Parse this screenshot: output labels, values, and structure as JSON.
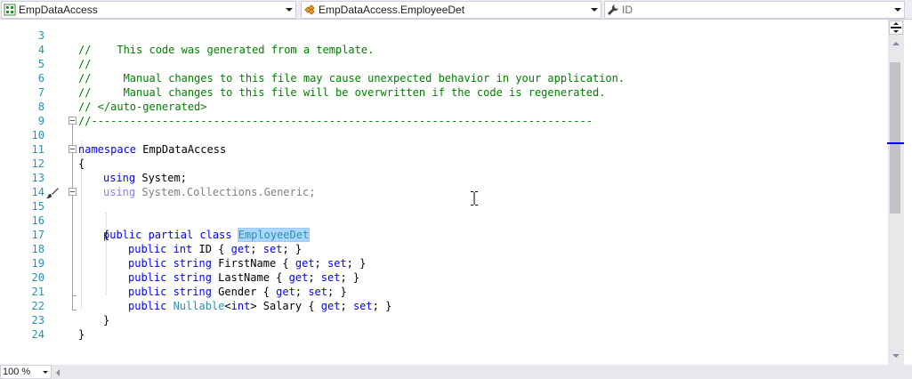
{
  "navbar": {
    "project": "EmpDataAccess",
    "type": "EmpDataAccess.EmployeeDet",
    "member": "ID"
  },
  "editor": {
    "lines": [
      {
        "num": "3",
        "code": "//    This code was generated from a template."
      },
      {
        "num": "4",
        "code": "//"
      },
      {
        "num": "5",
        "code": "//     Manual changes to this file may cause unexpected behavior in your application."
      },
      {
        "num": "6",
        "code": "//     Manual changes to this file will be overwritten if the code is regenerated."
      },
      {
        "num": "7",
        "code": "// </auto-generated>"
      },
      {
        "num": "8",
        "code": "//------------------------------------------------------------------------------"
      },
      {
        "num": "9",
        "code": ""
      },
      {
        "num": "10",
        "kw1": "namespace",
        "rest": " EmpDataAccess"
      },
      {
        "num": "11",
        "code": "{"
      },
      {
        "num": "12",
        "kw1": "using",
        "rest": " System;"
      },
      {
        "num": "13",
        "kw1": "using",
        "rest": " System.Collections.Generic;"
      },
      {
        "num": "14",
        "code": ""
      },
      {
        "num": "15",
        "kw1": "public partial class",
        "sel": "EmployeeDet"
      },
      {
        "num": "16",
        "code": "{"
      },
      {
        "num": "17",
        "kw1": "public int",
        "mid": " ID { ",
        "kw2": "get",
        "mid2": "; ",
        "kw3": "set",
        "end": "; }"
      },
      {
        "num": "18",
        "kw1": "public string",
        "mid": " FirstName { ",
        "kw2": "get",
        "mid2": "; ",
        "kw3": "set",
        "end": "; }"
      },
      {
        "num": "19",
        "kw1": "public string",
        "mid": " LastName { ",
        "kw2": "get",
        "mid2": "; ",
        "kw3": "set",
        "end": "; }"
      },
      {
        "num": "20",
        "kw1": "public string",
        "mid": " Gender { ",
        "kw2": "get",
        "mid2": "; ",
        "kw3": "set",
        "end": "; }"
      },
      {
        "num": "21",
        "kw1": "public",
        "ty": " Nullable",
        "mid0": "<",
        "kwint": "int",
        "mid": "> Salary { ",
        "kw2": "get",
        "mid2": "; ",
        "kw3": "set",
        "end": "; }"
      },
      {
        "num": "22",
        "code": "}"
      },
      {
        "num": "23",
        "code": "}"
      },
      {
        "num": "24",
        "code": ""
      }
    ]
  },
  "statusbar": {
    "zoom": "100 %"
  },
  "colors": {
    "keyword": "#0000ff",
    "comment": "#008000",
    "type": "#2b91af",
    "line_number": "#2b91af",
    "selection": "#add6ff"
  }
}
